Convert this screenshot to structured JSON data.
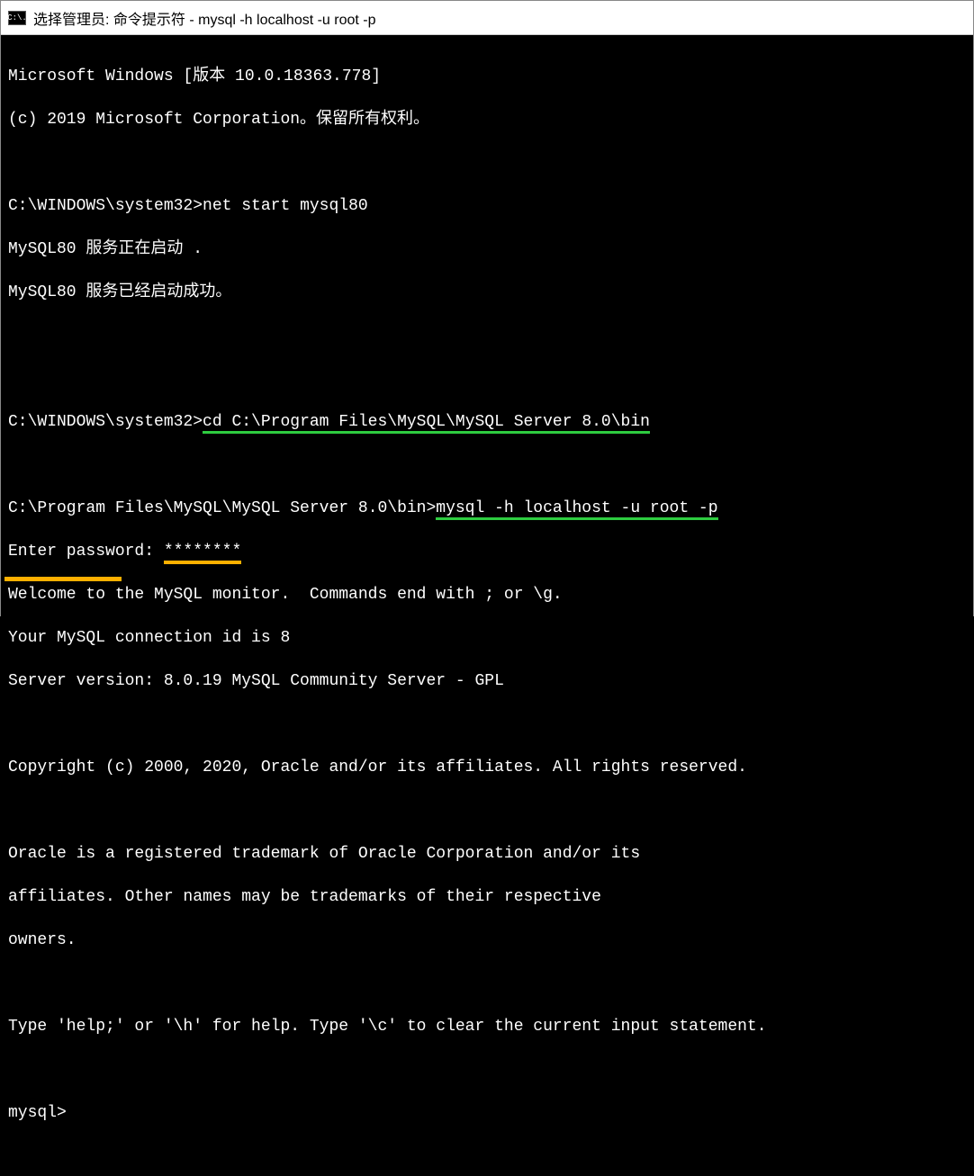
{
  "titlebar": {
    "icon_text": "C:\\.",
    "title": "选择管理员: 命令提示符 - mysql  -h localhost -u root -p"
  },
  "terminal": {
    "lines": {
      "l1": "Microsoft Windows [版本 10.0.18363.778]",
      "l2": "(c) 2019 Microsoft Corporation。保留所有权利。",
      "l3": "",
      "l4_prompt": "C:\\WINDOWS\\system32>",
      "l4_cmd": "net start mysql80",
      "l5": "MySQL80 服务正在启动 .",
      "l6": "MySQL80 服务已经启动成功。",
      "l7": "",
      "l8": "",
      "l9_prompt": "C:\\WINDOWS\\system32>",
      "l9_cmd": "cd C:\\Program Files\\MySQL\\MySQL Server 8.0\\bin",
      "l10": "",
      "l11_prompt": "C:\\Program Files\\MySQL\\MySQL Server 8.0\\bin>",
      "l11_cmd": "mysql -h localhost -u root -p",
      "l12_label": "Enter password: ",
      "l12_pw": "********",
      "l13": "Welcome to the MySQL monitor.  Commands end with ; or \\g.",
      "l14": "Your MySQL connection id is 8",
      "l15": "Server version: 8.0.19 MySQL Community Server - GPL",
      "l16": "",
      "l17": "Copyright (c) 2000, 2020, Oracle and/or its affiliates. All rights reserved.",
      "l18": "",
      "l19": "Oracle is a registered trademark of Oracle Corporation and/or its",
      "l20": "affiliates. Other names may be trademarks of their respective",
      "l21": "owners.",
      "l22": "",
      "l23": "Type 'help;' or '\\h' for help. Type '\\c' to clear the current input statement.",
      "l24": "",
      "l25_prompt": "mysql>",
      "l25_cursor": " "
    }
  }
}
